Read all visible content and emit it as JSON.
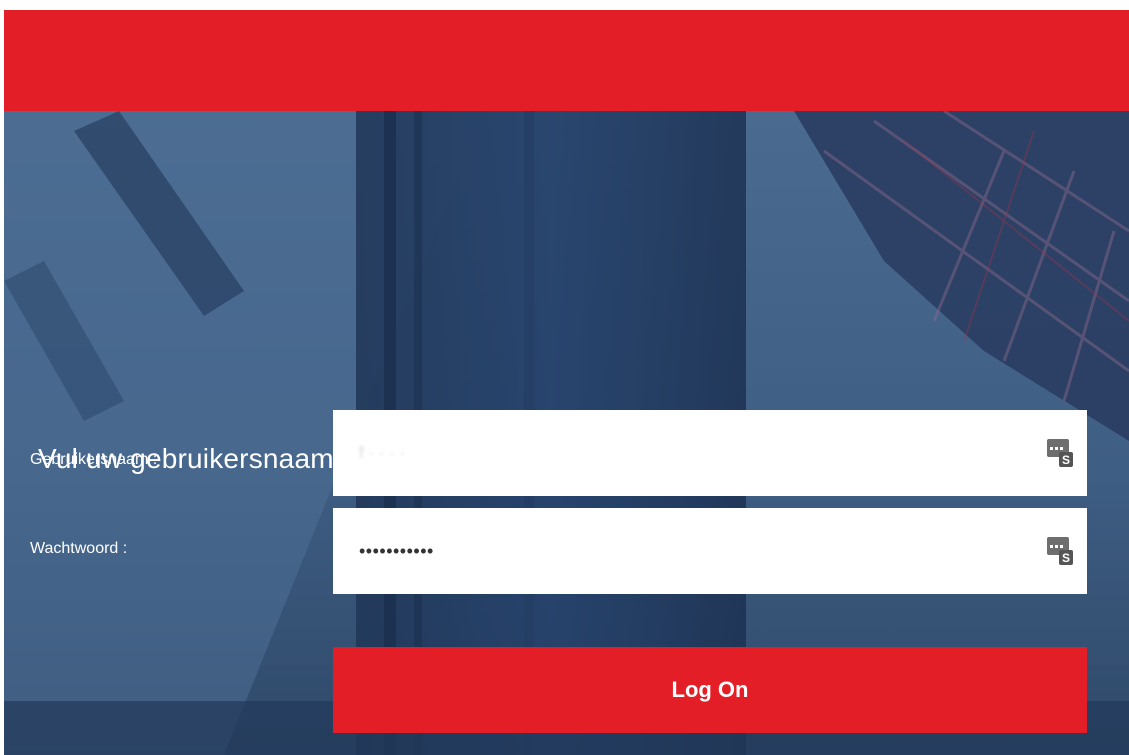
{
  "colors": {
    "brand_red": "#e41e26",
    "backdrop_blue": "#3d5a7e"
  },
  "login": {
    "title": "Vul uw gebruikersnaam en wachtwoord in",
    "username": {
      "label": "Gebruikersnaam :",
      "value": "f  ·    ·  ·  ·",
      "icon": "keypad-key-icon"
    },
    "password": {
      "label": "Wachtwoord :",
      "value": "•••••••••••",
      "icon": "keypad-key-icon"
    },
    "submit_label": "Log On"
  }
}
